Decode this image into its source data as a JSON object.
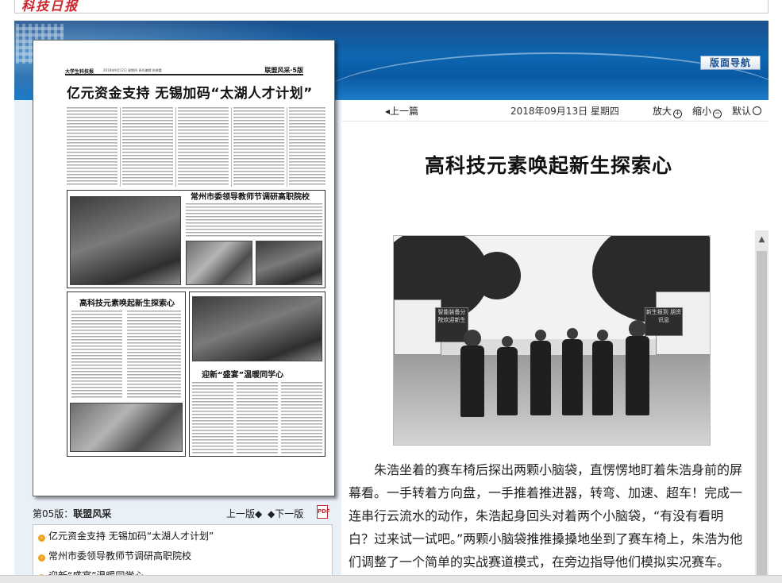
{
  "masthead": {
    "logo": "科技日报"
  },
  "banner": {
    "nav_button": "版面导航"
  },
  "newspaper_page": {
    "header_left": "大学生科技报",
    "header_date": "2018年9月12日 星期四 责任编辑:张晓蕾",
    "header_right": "联盟风采·5版",
    "headline": "亿元资金支持 无锡加码“太湖人才计划”",
    "sub1": "常州市委领导教师节调研高职院校",
    "sub2": "高科技元素唤起新生探索心",
    "sub3": "迎新“盛宴”温暖同学心"
  },
  "page_info": {
    "page_num": "第05版：",
    "page_name": "联盟风采",
    "prev_page": "上一版",
    "next_page": "下一版",
    "pdf_icon": "PDF"
  },
  "article_list": [
    "亿元资金支持 无锡加码“太湖人才计划”",
    "常州市委领导教师节调研高职院校",
    "迎新“盛宴”温暖同学心"
  ],
  "toolbar": {
    "prev_article": "上一篇",
    "date": "2018年09月13日 星期四",
    "zoom_in": "放大",
    "zoom_out": "缩小",
    "zoom_reset": "默认"
  },
  "article": {
    "title": "高科技元素唤起新生探索心",
    "body": "朱浩坐着的赛车椅后探出两颗小脑袋，直愣愣地盯着朱浩身前的屏幕看。一手转着方向盘，一手推着推进器，转弯、加速、超车！完成一连串行云流水的动作，朱浩起身回头对着两个小脑袋，“有没有看明白？过来试一试吧。”两颗小脑袋推推搡搡地坐到了赛车椅上，朱浩为他们调整了一个简单的实战赛道模式，在旁边指导他们模拟实况赛车。",
    "photo_sign_left": "智能装备分院欢迎新生",
    "photo_sign_right": "新生报到 朋资讯息"
  },
  "colors": {
    "banner_blue": "#0d66b1",
    "bullet_orange": "#f0a21c",
    "pdf_red": "#c4262e",
    "masthead_red": "#c8242a"
  }
}
